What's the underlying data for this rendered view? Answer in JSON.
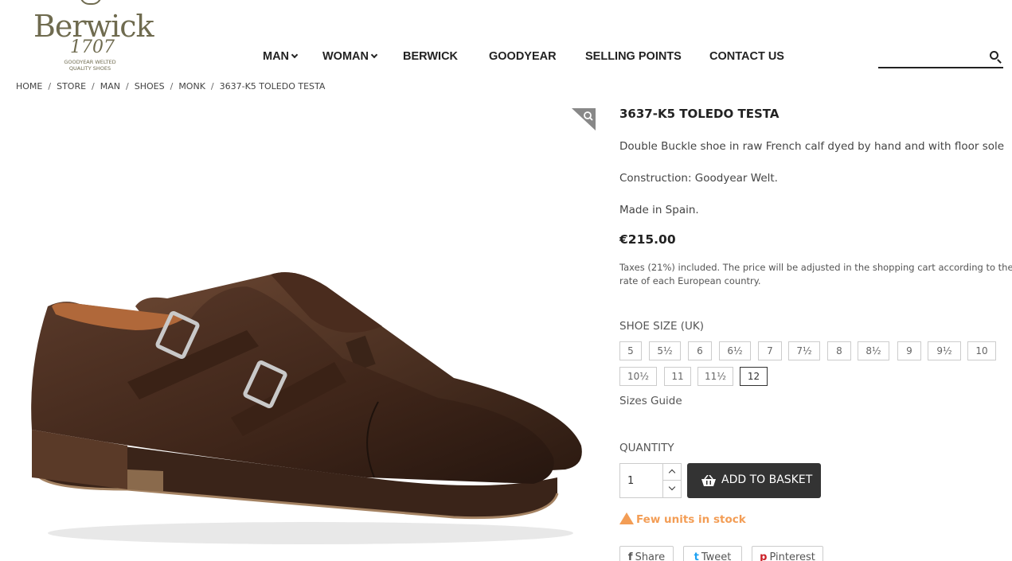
{
  "brand": {
    "name": "Berwick",
    "year": "1707",
    "tagline": "GOODYEAR WELTED QUALITY SHOES"
  },
  "nav": {
    "items": [
      {
        "label": "MAN",
        "has_dropdown": true
      },
      {
        "label": "WOMAN",
        "has_dropdown": true
      },
      {
        "label": "BERWICK",
        "has_dropdown": false
      },
      {
        "label": "GOODYEAR",
        "has_dropdown": false
      },
      {
        "label": "SELLING POINTS",
        "has_dropdown": false
      },
      {
        "label": "CONTACT US",
        "has_dropdown": false
      }
    ],
    "search_placeholder": ""
  },
  "breadcrumb": [
    "HOME",
    "STORE",
    "MAN",
    "SHOES",
    "MONK",
    "3637-K5 TOLEDO TESTA"
  ],
  "product": {
    "title": "3637-K5 TOLEDO TESTA",
    "description": "Double Buckle shoe in raw French calf dyed by hand and with floor sole",
    "construction": "Construction: Goodyear Welt.",
    "origin": "Made in Spain.",
    "price": "€215.00",
    "tax_note": "Taxes (21%) included. The price will be adjusted in the shopping cart according to the VAT rate of each European country.",
    "size_label": "SHOE SIZE (UK)",
    "sizes": [
      "5",
      "5½",
      "6",
      "6½",
      "7",
      "7½",
      "8",
      "8½",
      "9",
      "9½",
      "10",
      "10½",
      "11",
      "11½",
      "12"
    ],
    "selected_size": "12",
    "sizes_guide": "Sizes Guide",
    "quantity_label": "QUANTITY",
    "quantity_value": "1",
    "add_to_basket": "ADD TO BASKET",
    "stock_status": "Few units in stock",
    "stock_color": "#f39d55"
  },
  "share": [
    {
      "label": "Share",
      "icon": "facebook-icon",
      "glyph": "f"
    },
    {
      "label": "Tweet",
      "icon": "twitter-icon",
      "glyph": "t"
    },
    {
      "label": "Pinterest",
      "icon": "pinterest-icon",
      "glyph": "p"
    }
  ],
  "colors": {
    "brand": "#6f6b4f",
    "button": "#333333",
    "leather": "#4a2f22"
  }
}
